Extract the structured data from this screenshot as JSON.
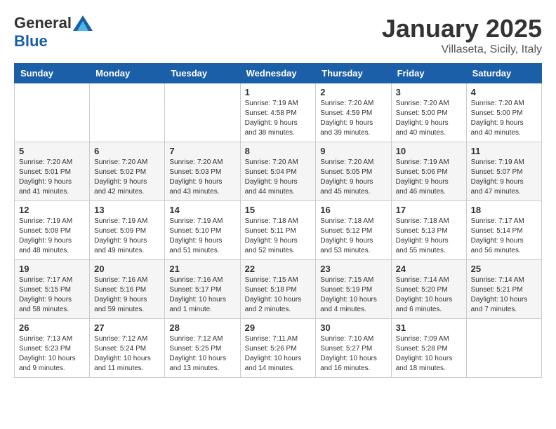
{
  "logo": {
    "general": "General",
    "blue": "Blue"
  },
  "title": "January 2025",
  "subtitle": "Villaseta, Sicily, Italy",
  "days_of_week": [
    "Sunday",
    "Monday",
    "Tuesday",
    "Wednesday",
    "Thursday",
    "Friday",
    "Saturday"
  ],
  "weeks": [
    [
      {
        "day": "",
        "info": ""
      },
      {
        "day": "",
        "info": ""
      },
      {
        "day": "",
        "info": ""
      },
      {
        "day": "1",
        "info": "Sunrise: 7:19 AM\nSunset: 4:58 PM\nDaylight: 9 hours\nand 38 minutes."
      },
      {
        "day": "2",
        "info": "Sunrise: 7:20 AM\nSunset: 4:59 PM\nDaylight: 9 hours\nand 39 minutes."
      },
      {
        "day": "3",
        "info": "Sunrise: 7:20 AM\nSunset: 5:00 PM\nDaylight: 9 hours\nand 40 minutes."
      },
      {
        "day": "4",
        "info": "Sunrise: 7:20 AM\nSunset: 5:00 PM\nDaylight: 9 hours\nand 40 minutes."
      }
    ],
    [
      {
        "day": "5",
        "info": "Sunrise: 7:20 AM\nSunset: 5:01 PM\nDaylight: 9 hours\nand 41 minutes."
      },
      {
        "day": "6",
        "info": "Sunrise: 7:20 AM\nSunset: 5:02 PM\nDaylight: 9 hours\nand 42 minutes."
      },
      {
        "day": "7",
        "info": "Sunrise: 7:20 AM\nSunset: 5:03 PM\nDaylight: 9 hours\nand 43 minutes."
      },
      {
        "day": "8",
        "info": "Sunrise: 7:20 AM\nSunset: 5:04 PM\nDaylight: 9 hours\nand 44 minutes."
      },
      {
        "day": "9",
        "info": "Sunrise: 7:20 AM\nSunset: 5:05 PM\nDaylight: 9 hours\nand 45 minutes."
      },
      {
        "day": "10",
        "info": "Sunrise: 7:19 AM\nSunset: 5:06 PM\nDaylight: 9 hours\nand 46 minutes."
      },
      {
        "day": "11",
        "info": "Sunrise: 7:19 AM\nSunset: 5:07 PM\nDaylight: 9 hours\nand 47 minutes."
      }
    ],
    [
      {
        "day": "12",
        "info": "Sunrise: 7:19 AM\nSunset: 5:08 PM\nDaylight: 9 hours\nand 48 minutes."
      },
      {
        "day": "13",
        "info": "Sunrise: 7:19 AM\nSunset: 5:09 PM\nDaylight: 9 hours\nand 49 minutes."
      },
      {
        "day": "14",
        "info": "Sunrise: 7:19 AM\nSunset: 5:10 PM\nDaylight: 9 hours\nand 51 minutes."
      },
      {
        "day": "15",
        "info": "Sunrise: 7:18 AM\nSunset: 5:11 PM\nDaylight: 9 hours\nand 52 minutes."
      },
      {
        "day": "16",
        "info": "Sunrise: 7:18 AM\nSunset: 5:12 PM\nDaylight: 9 hours\nand 53 minutes."
      },
      {
        "day": "17",
        "info": "Sunrise: 7:18 AM\nSunset: 5:13 PM\nDaylight: 9 hours\nand 55 minutes."
      },
      {
        "day": "18",
        "info": "Sunrise: 7:17 AM\nSunset: 5:14 PM\nDaylight: 9 hours\nand 56 minutes."
      }
    ],
    [
      {
        "day": "19",
        "info": "Sunrise: 7:17 AM\nSunset: 5:15 PM\nDaylight: 9 hours\nand 58 minutes."
      },
      {
        "day": "20",
        "info": "Sunrise: 7:16 AM\nSunset: 5:16 PM\nDaylight: 9 hours\nand 59 minutes."
      },
      {
        "day": "21",
        "info": "Sunrise: 7:16 AM\nSunset: 5:17 PM\nDaylight: 10 hours\nand 1 minute."
      },
      {
        "day": "22",
        "info": "Sunrise: 7:15 AM\nSunset: 5:18 PM\nDaylight: 10 hours\nand 2 minutes."
      },
      {
        "day": "23",
        "info": "Sunrise: 7:15 AM\nSunset: 5:19 PM\nDaylight: 10 hours\nand 4 minutes."
      },
      {
        "day": "24",
        "info": "Sunrise: 7:14 AM\nSunset: 5:20 PM\nDaylight: 10 hours\nand 6 minutes."
      },
      {
        "day": "25",
        "info": "Sunrise: 7:14 AM\nSunset: 5:21 PM\nDaylight: 10 hours\nand 7 minutes."
      }
    ],
    [
      {
        "day": "26",
        "info": "Sunrise: 7:13 AM\nSunset: 5:23 PM\nDaylight: 10 hours\nand 9 minutes."
      },
      {
        "day": "27",
        "info": "Sunrise: 7:12 AM\nSunset: 5:24 PM\nDaylight: 10 hours\nand 11 minutes."
      },
      {
        "day": "28",
        "info": "Sunrise: 7:12 AM\nSunset: 5:25 PM\nDaylight: 10 hours\nand 13 minutes."
      },
      {
        "day": "29",
        "info": "Sunrise: 7:11 AM\nSunset: 5:26 PM\nDaylight: 10 hours\nand 14 minutes."
      },
      {
        "day": "30",
        "info": "Sunrise: 7:10 AM\nSunset: 5:27 PM\nDaylight: 10 hours\nand 16 minutes."
      },
      {
        "day": "31",
        "info": "Sunrise: 7:09 AM\nSunset: 5:28 PM\nDaylight: 10 hours\nand 18 minutes."
      },
      {
        "day": "",
        "info": ""
      }
    ]
  ]
}
